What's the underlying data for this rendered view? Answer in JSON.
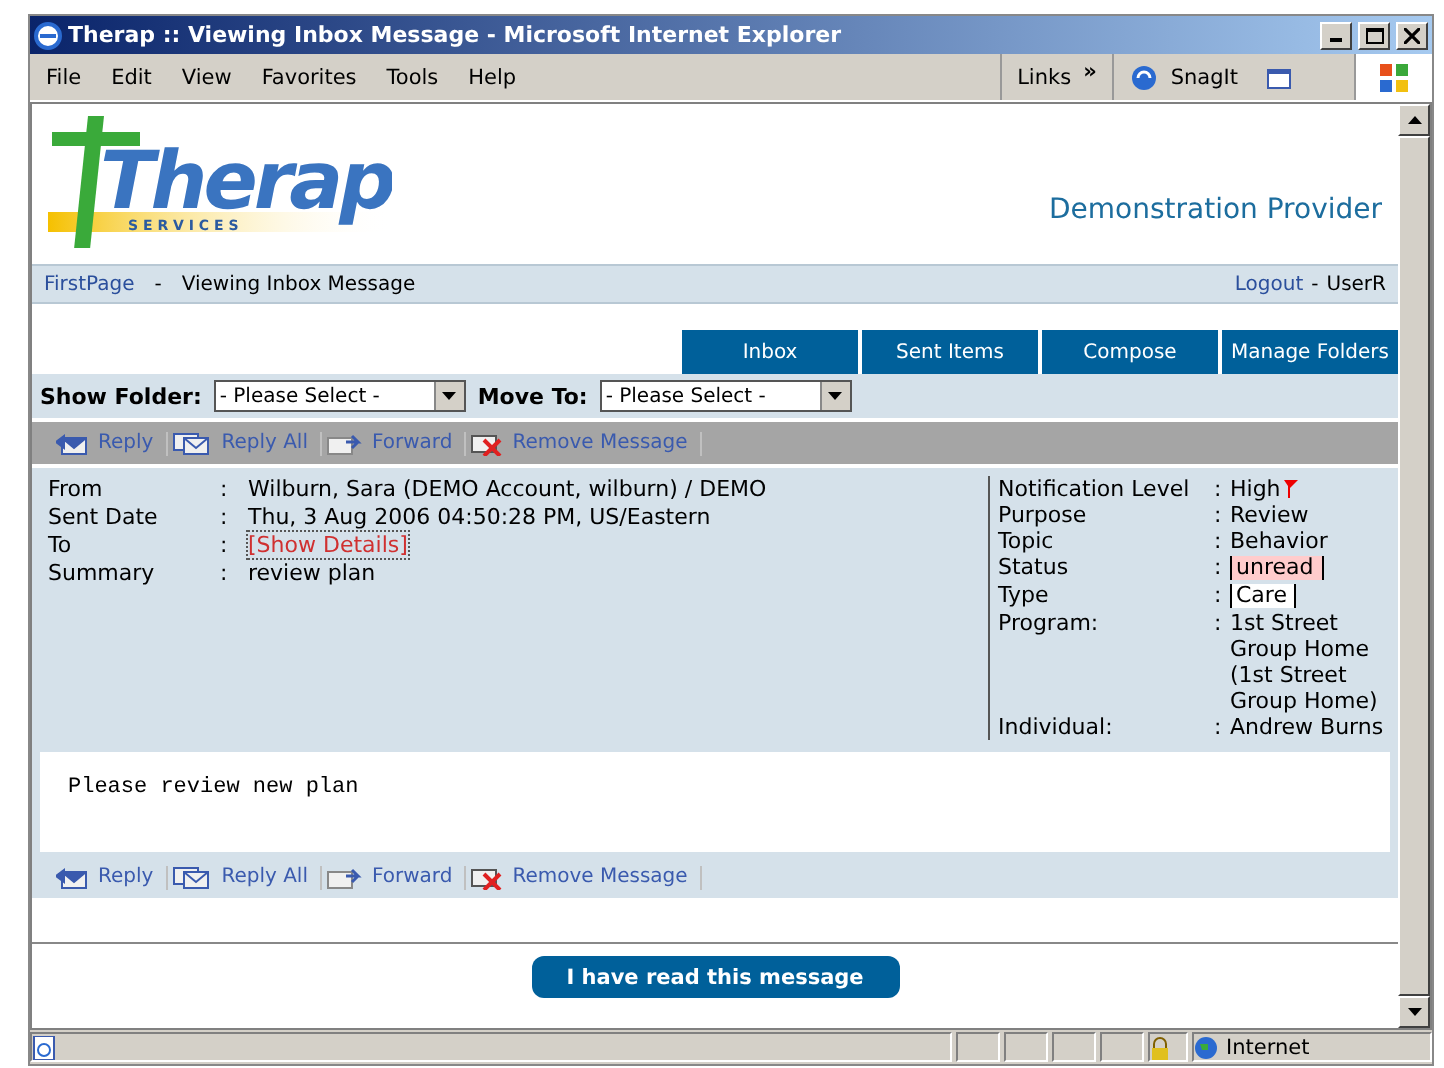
{
  "window": {
    "title": "Therap :: Viewing Inbox Message - Microsoft Internet Explorer"
  },
  "menu": [
    "File",
    "Edit",
    "View",
    "Favorites",
    "Tools",
    "Help"
  ],
  "browser_toolbar": {
    "links": "Links",
    "chevron": "»",
    "snagit": "SnagIt"
  },
  "logo": {
    "name": "Therap",
    "tagline": "S E R V I C E S"
  },
  "provider": "Demonstration Provider",
  "breadcrumb": {
    "home": "FirstPage",
    "separator": "-",
    "current": "Viewing Inbox Message",
    "logout": "Logout",
    "user_separator": "-",
    "user": "UserR"
  },
  "tabs": [
    "Inbox",
    "Sent Items",
    "Compose",
    "Manage Folders"
  ],
  "filters": [
    {
      "label": "Show Folder:",
      "placeholder": "- Please Select -"
    },
    {
      "label": "Move To:",
      "placeholder": "- Please Select -"
    }
  ],
  "actions_top": [
    {
      "kind": "reply",
      "label": "Reply"
    },
    {
      "kind": "replyall",
      "label": "Reply All"
    },
    {
      "kind": "forward",
      "label": "Forward"
    },
    {
      "kind": "remove",
      "label": "Remove Message"
    }
  ],
  "detail_separator": ":",
  "details_left": [
    {
      "label": "From",
      "value": "Wilburn, Sara (DEMO Account, wilburn) / DEMO",
      "kind": "text"
    },
    {
      "label": "Sent Date",
      "value": "Thu, 3 Aug 2006 04:50:28 PM, US/Eastern",
      "kind": "text"
    },
    {
      "label": "To",
      "value": "[Show Details]",
      "kind": "link"
    },
    {
      "label": "Summary",
      "value": "review plan",
      "kind": "text"
    }
  ],
  "details_right": [
    {
      "label": "Notification Level",
      "value": "High",
      "kind": "flag"
    },
    {
      "label": "Purpose",
      "value": "Review",
      "kind": "text"
    },
    {
      "label": "Topic",
      "value": "Behavior",
      "kind": "text"
    },
    {
      "label": "Status",
      "value": "unread",
      "kind": "tag",
      "color": "#ffcccc"
    },
    {
      "label": "Type",
      "value": "Care",
      "kind": "tag",
      "color": "#ffffff"
    },
    {
      "label": "Program:",
      "value": "1st Street Group Home (1st Street Group Home)",
      "kind": "text"
    },
    {
      "label": "Individual:",
      "value": "Andrew Burns",
      "kind": "text"
    }
  ],
  "message_body": "Please review new plan",
  "actions_bottom": [
    {
      "kind": "reply",
      "label": "Reply"
    },
    {
      "kind": "replyall",
      "label": "Reply All"
    },
    {
      "kind": "forward",
      "label": "Forward"
    },
    {
      "kind": "remove",
      "label": "Remove Message"
    }
  ],
  "read_button": "I have read this message",
  "status_bar": {
    "zone": "Internet"
  }
}
